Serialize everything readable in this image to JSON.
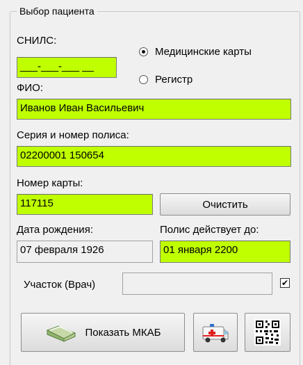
{
  "group_title": "Выбор пациента",
  "snils": {
    "label": "СНИЛС:",
    "mask": "___-___-___ __"
  },
  "source_radio": {
    "option_med": "Медицинские карты",
    "option_reg": "Регистр",
    "selected": "Медицинские карты"
  },
  "fio": {
    "label": "ФИО:",
    "value": "Иванов Иван Васильевич"
  },
  "policy": {
    "label": "Серия и номер полиса:",
    "value": "02200001 150654"
  },
  "card": {
    "label": "Номер карты:",
    "value": "117115"
  },
  "clear_button": "Очистить",
  "birth": {
    "label": "Дата рождения:",
    "value": "07 февраля 1926"
  },
  "policy_valid": {
    "label": "Полис действует до:",
    "value": "01 января 2200"
  },
  "district": {
    "label": "Участок (Врач)",
    "value": "",
    "checked": true,
    "check_glyph": "✔"
  },
  "show_mkab_button": "Показать МКАБ",
  "colors": {
    "required_field": "#bfff00",
    "background": "#f0f0f0"
  },
  "icons": {
    "mkab": "book-icon",
    "ambulance": "ambulance-icon",
    "qr": "qr-code-icon"
  }
}
